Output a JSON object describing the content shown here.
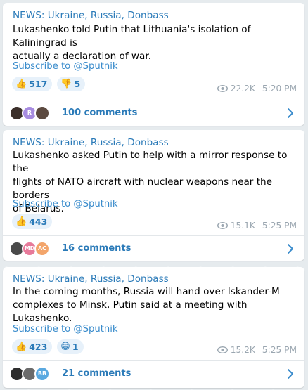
{
  "posts": [
    {
      "tag": "NEWS: Ukraine, Russia, Donbass",
      "text_lines": [
        "Lukashenko told Putin that Lithuania's isolation of Kaliningrad is",
        "actually a declaration of war."
      ],
      "subscribe": "Subscribe to @Sputnik",
      "reactions": [
        {
          "emoji": "👍",
          "count": "517"
        },
        {
          "emoji": "👎",
          "count": "5"
        }
      ],
      "views": "22.2K",
      "time": "5:20 PM",
      "comments": "100 comments",
      "avatars": [
        {
          "initials": "",
          "color": "#3b2f2a"
        },
        {
          "initials": "R",
          "color": "#a78ce0"
        },
        {
          "initials": "",
          "color": "#5c4a40"
        }
      ]
    },
    {
      "tag": "NEWS: Ukraine, Russia, Donbass",
      "text_lines": [
        "Lukashenko asked Putin to help with a mirror response to the",
        "flights of NATO aircraft with nuclear weapons near the borders",
        "of Belarus."
      ],
      "subscribe": "Subscribe to @Sputnik",
      "reactions": [
        {
          "emoji": "👍",
          "count": "443"
        }
      ],
      "views": "15.1K",
      "time": "5:25 PM",
      "comments": "16 comments",
      "avatars": [
        {
          "initials": "",
          "color": "#4a4a4a"
        },
        {
          "initials": "MD",
          "color": "#e77a9a"
        },
        {
          "initials": "AC",
          "color": "#f3a56b"
        }
      ]
    },
    {
      "tag": "NEWS: Ukraine, Russia, Donbass",
      "text_lines": [
        "In the coming months, Russia will hand over Iskander-M",
        "complexes to Minsk, Putin said at a meeting with Lukashenko."
      ],
      "subscribe": "Subscribe to @Sputnik",
      "reactions": [
        {
          "emoji": "👍",
          "count": "423"
        },
        {
          "emoji": "😁",
          "count": "1"
        }
      ],
      "views": "15.2K",
      "time": "5:25 PM",
      "comments": "21 comments",
      "avatars": [
        {
          "initials": "",
          "color": "#2e2e2e"
        },
        {
          "initials": "",
          "color": "#6b6b6b"
        },
        {
          "initials": "BB",
          "color": "#5aa9e0"
        }
      ]
    }
  ],
  "colors": {
    "accent": "#2a7ab8",
    "background": "#e6ebee",
    "meta": "#9aa6b0"
  }
}
